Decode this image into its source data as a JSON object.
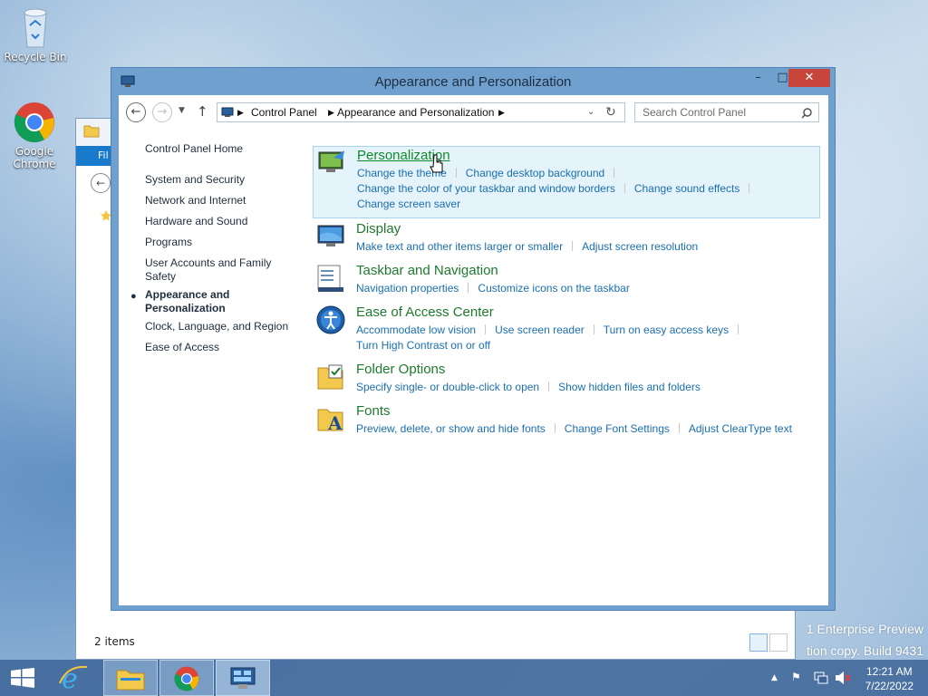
{
  "desktop": {
    "icons": [
      {
        "label": "Recycle Bin",
        "icon": "recycle-bin-icon"
      },
      {
        "label": "Google Chrome",
        "icon": "chrome-icon"
      }
    ],
    "watermark_line1": "1 Enterprise Preview",
    "watermark_line2": "tion copy. Build 9431"
  },
  "background_window": {
    "ribbon_label": "Fil",
    "status": "2 items"
  },
  "window": {
    "title": "Appearance and Personalization",
    "controls": {
      "minimize": "–",
      "maximize": "□",
      "close": "✕"
    },
    "address": {
      "crumbs": [
        "Control Panel",
        "Appearance and Personalization"
      ]
    },
    "search": {
      "placeholder": "Search Control Panel"
    }
  },
  "leftnav": {
    "home": "Control Panel Home",
    "items": [
      {
        "label": "System and Security",
        "active": false
      },
      {
        "label": "Network and Internet",
        "active": false
      },
      {
        "label": "Hardware and Sound",
        "active": false
      },
      {
        "label": "Programs",
        "active": false
      },
      {
        "label": "User Accounts and Family Safety",
        "active": false
      },
      {
        "label": "Appearance and Personalization",
        "active": true
      },
      {
        "label": "Clock, Language, and Region",
        "active": false
      },
      {
        "label": "Ease of Access",
        "active": false
      }
    ]
  },
  "categories": [
    {
      "heading": "Personalization",
      "icon": "personalization-icon",
      "links": [
        "Change the theme",
        "Change desktop background",
        "Change the color of your taskbar and window borders",
        "Change sound effects",
        "Change screen saver"
      ]
    },
    {
      "heading": "Display",
      "icon": "display-icon",
      "links": [
        "Make text and other items larger or smaller",
        "Adjust screen resolution"
      ]
    },
    {
      "heading": "Taskbar and Navigation",
      "icon": "taskbar-icon",
      "links": [
        "Navigation properties",
        "Customize icons on the taskbar"
      ]
    },
    {
      "heading": "Ease of Access Center",
      "icon": "ease-of-access-icon",
      "links": [
        "Accommodate low vision",
        "Use screen reader",
        "Turn on easy access keys",
        "Turn High Contrast on or off"
      ]
    },
    {
      "heading": "Folder Options",
      "icon": "folder-options-icon",
      "links": [
        "Specify single- or double-click to open",
        "Show hidden files and folders"
      ]
    },
    {
      "heading": "Fonts",
      "icon": "fonts-icon",
      "links": [
        "Preview, delete, or show and hide fonts",
        "Change Font Settings",
        "Adjust ClearType text"
      ]
    }
  ],
  "taskbar": {
    "apps": [
      "start-icon",
      "internet-explorer-icon",
      "file-explorer-icon",
      "chrome-icon",
      "control-panel-icon"
    ],
    "clock_time": "12:21 AM",
    "clock_date": "7/22/2022"
  },
  "colors": {
    "heading_green": "#1f7a2e",
    "link_blue": "#1a6fb0",
    "highlight_bg": "#e5f3fb",
    "close_red": "#c7453b"
  }
}
